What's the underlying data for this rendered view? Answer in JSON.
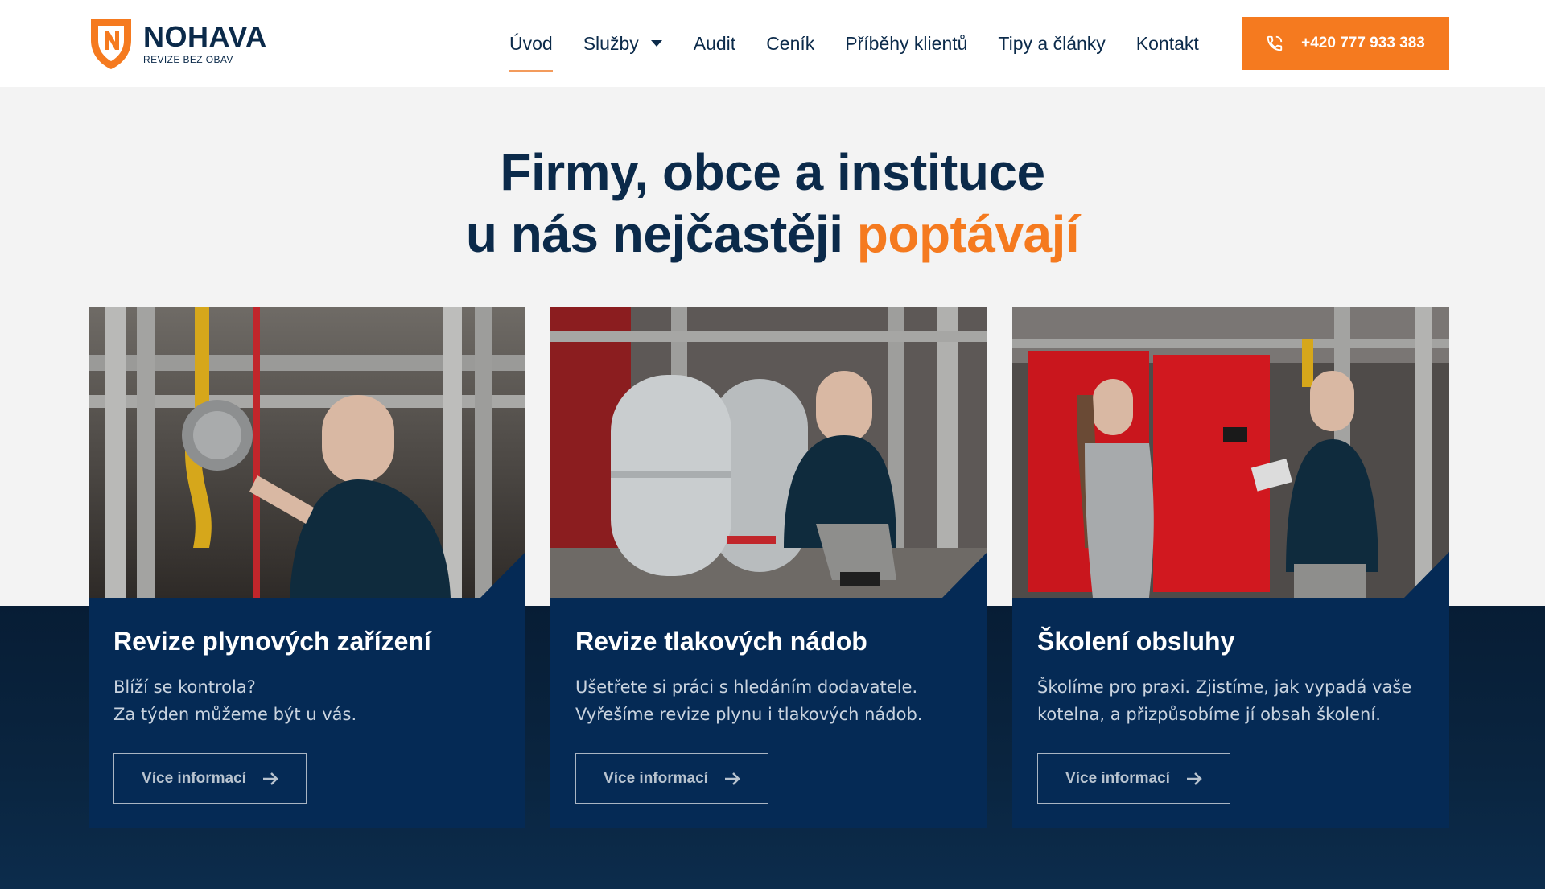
{
  "brand": {
    "name": "NOHAVA",
    "tagline": "REVIZE BEZ OBAV",
    "logo_icon": "shield-n-icon",
    "colors": {
      "orange": "#f57a1f",
      "navy": "#0b2a4a",
      "card_bg": "#052a55"
    }
  },
  "nav": {
    "items": [
      {
        "label": "Úvod",
        "active": true
      },
      {
        "label": "Služby",
        "has_dropdown": true
      },
      {
        "label": "Audit"
      },
      {
        "label": "Ceník"
      },
      {
        "label": "Příběhy klientů"
      },
      {
        "label": "Tipy a články"
      },
      {
        "label": "Kontakt"
      }
    ],
    "phone": {
      "label": "+420 777 933 383",
      "icon": "phone-icon"
    }
  },
  "hero": {
    "line1": "Firmy, obce a instituce",
    "line2_prefix": "u nás nejčastěji ",
    "line2_accent": "poptávají"
  },
  "cards": [
    {
      "title": "Revize plynových zařízení",
      "text_line1": "Blíží se kontrola?",
      "text_line2": "Za týden můžeme být u vás.",
      "button": "Více informací",
      "image": "technician-at-gas-valve-photo"
    },
    {
      "title": "Revize tlakových nádob",
      "text_line1": "Ušetřete si práci s hledáním dodavatele.",
      "text_line2": "Vyřešíme revize plynu i tlakových nádob.",
      "button": "Více informací",
      "image": "technician-at-pressure-vessel-photo"
    },
    {
      "title": "Školení obsluhy",
      "text_line1": "Školíme pro praxi. Zjistíme, jak vypadá vaše",
      "text_line2": "kotelna, a přizpůsobíme jí obsah školení.",
      "button": "Více informací",
      "image": "training-in-boiler-room-photo"
    }
  ]
}
